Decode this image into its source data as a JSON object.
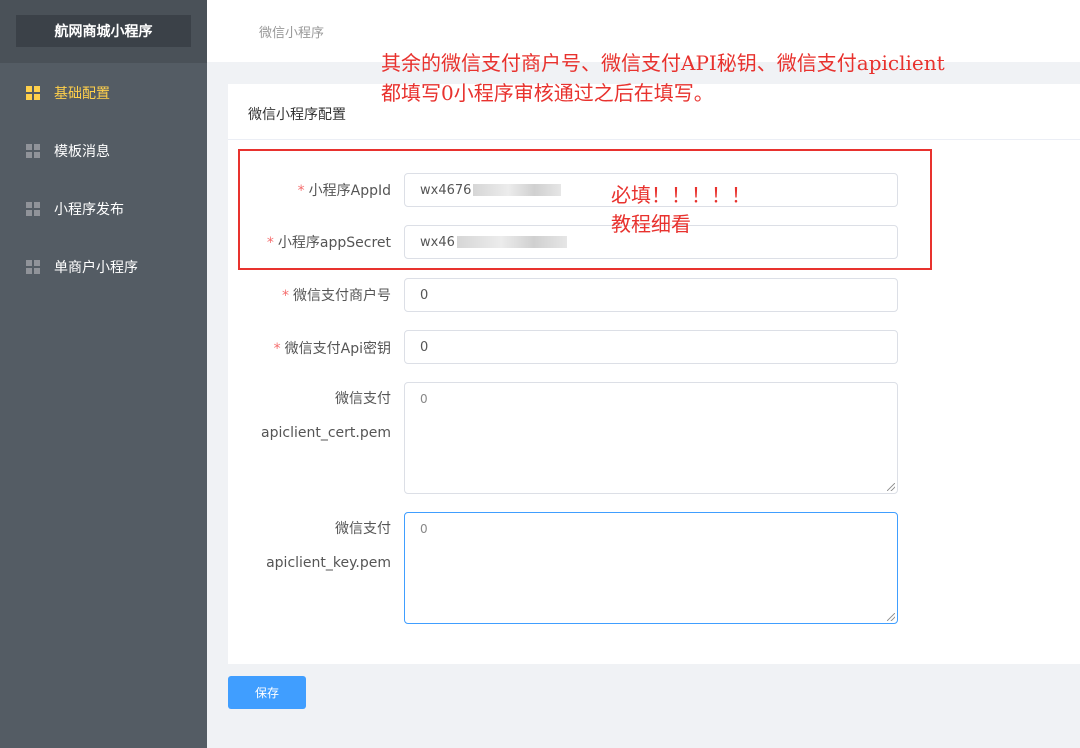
{
  "sidebar": {
    "brand": "航网商城小程序",
    "items": [
      {
        "label": "基础配置",
        "active": true
      },
      {
        "label": "模板消息",
        "active": false
      },
      {
        "label": "小程序发布",
        "active": false
      },
      {
        "label": "单商户小程序",
        "active": false
      }
    ]
  },
  "breadcrumb": "微信小程序",
  "card": {
    "title": "微信小程序配置"
  },
  "form": {
    "appid": {
      "label": "小程序AppId",
      "required": true,
      "value": "wx4676"
    },
    "appsecret": {
      "label": "小程序appSecret",
      "required": true,
      "value": "wx46"
    },
    "mch_id": {
      "label": "微信支付商户号",
      "required": true,
      "value": "0"
    },
    "api_key": {
      "label": "微信支付Api密钥",
      "required": true,
      "value": "0"
    },
    "cert": {
      "label_line1": "微信支付",
      "label_line2": "apiclient_cert.pem",
      "value": "0"
    },
    "key": {
      "label_line1": "微信支付",
      "label_line2": "apiclient_key.pem",
      "value": "0"
    }
  },
  "save_label": "保存",
  "annotations": {
    "note_line1": "其余的微信支付商户号、微信支付API秘钥、微信支付apiclient",
    "note_line2": "都填写0小程序审核通过之后在填写。",
    "required_line1": "必填！！！！！",
    "required_line2": "教程细看",
    "color": "#e8322e"
  },
  "colors": {
    "sidebar_bg": "#545c64",
    "active": "#ffd04b",
    "primary": "#409eff",
    "required_star": "#f56c6c"
  }
}
